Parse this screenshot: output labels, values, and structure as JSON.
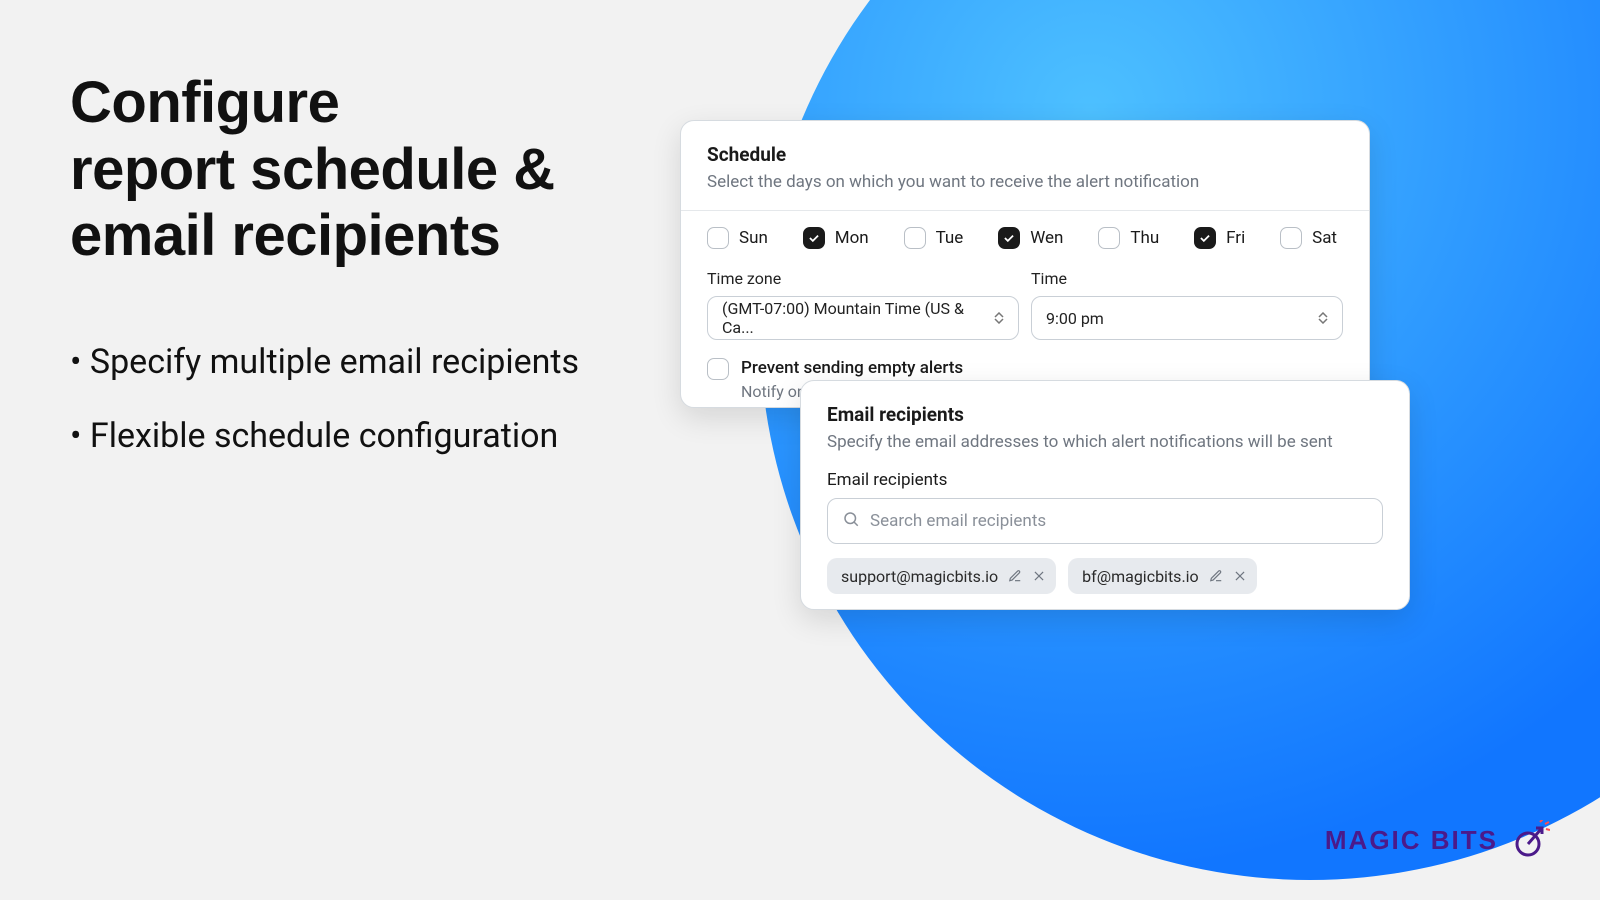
{
  "hero": {
    "headline_l1": "Configure",
    "headline_l2": "report schedule &",
    "headline_l3": "email recipients",
    "bullet1": "Specify multiple email recipients",
    "bullet2": "Flexible schedule configuration"
  },
  "schedule_card": {
    "title": "Schedule",
    "subtitle": "Select the days on which you want to receive the alert notification",
    "days": [
      {
        "label": "Sun",
        "checked": false
      },
      {
        "label": "Mon",
        "checked": true
      },
      {
        "label": "Tue",
        "checked": false
      },
      {
        "label": "Wen",
        "checked": true
      },
      {
        "label": "Thu",
        "checked": false
      },
      {
        "label": "Fri",
        "checked": true
      },
      {
        "label": "Sat",
        "checked": false
      }
    ],
    "timezone_label": "Time zone",
    "timezone_value": "(GMT-07:00) Mountain Time (US & Ca...",
    "time_label": "Time",
    "time_value": "9:00 pm",
    "prevent_title": "Prevent sending empty alerts",
    "prevent_sub": "Notify only if there is at least one low stocked product"
  },
  "email_card": {
    "title": "Email recipients",
    "subtitle": "Specify the email addresses to which alert notifications will be sent",
    "field_label": "Email recipients",
    "search_placeholder": "Search email recipients",
    "chips": [
      "support@magicbits.io",
      "bf@magicbits.io"
    ]
  },
  "brand": {
    "name": "MAGIC BITS"
  }
}
